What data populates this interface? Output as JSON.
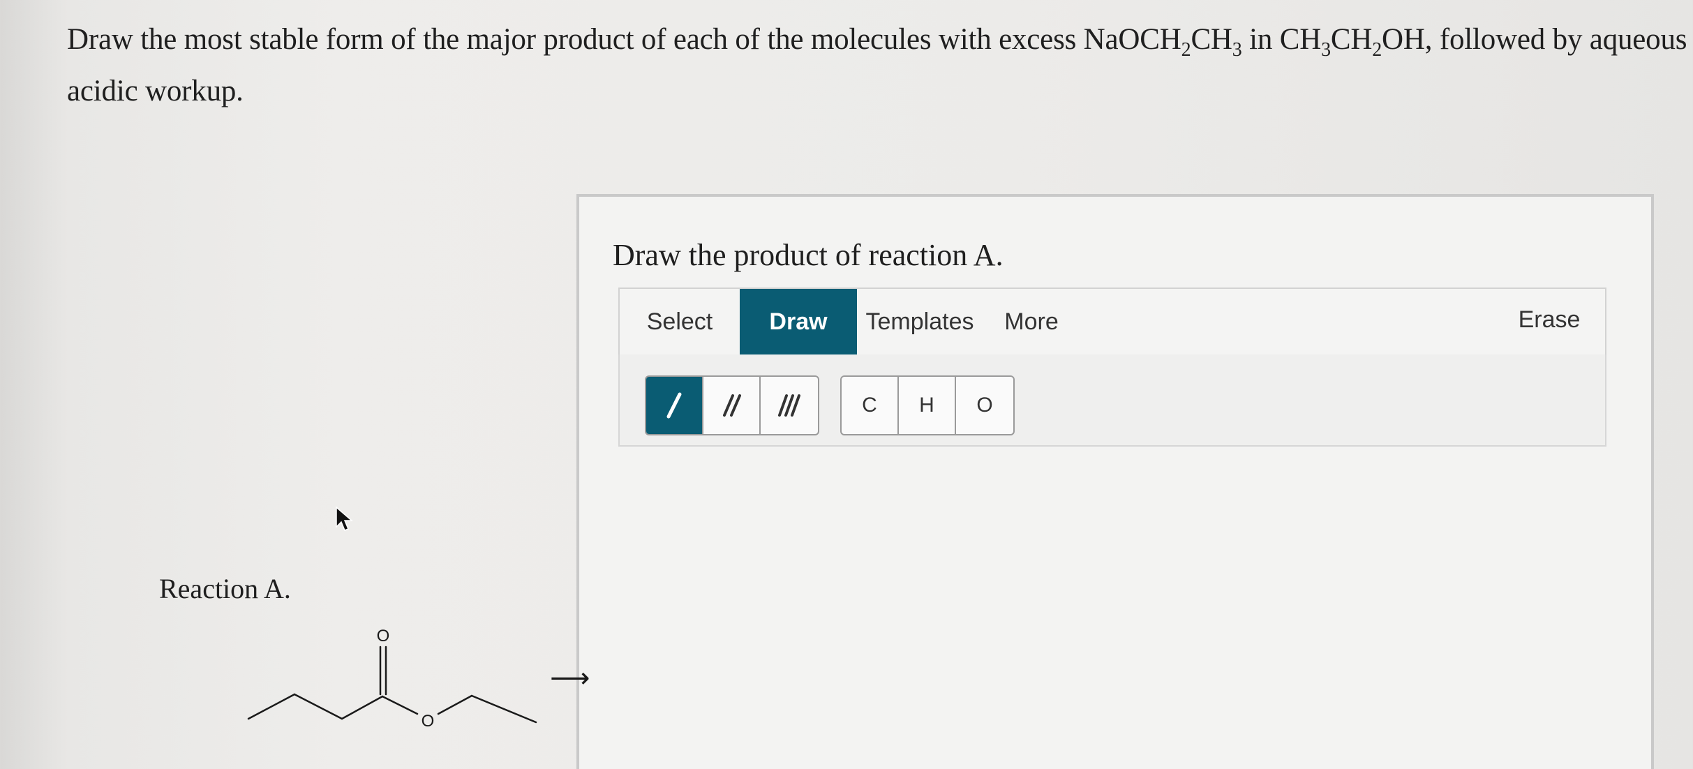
{
  "question": {
    "text_prefix": "Draw the most stable form of the major product of each of the molecules with excess NaOCH",
    "sub1": "2",
    "mid1": "CH",
    "sub2": "3",
    "mid2": " in CH",
    "sub3": "3",
    "mid3": "CH",
    "sub4": "2",
    "text_suffix": "OH, followed by aqueous acidic workup."
  },
  "panel": {
    "title": "Draw the product of reaction A."
  },
  "toolbar": {
    "tabs": [
      "Select",
      "Draw",
      "Templates",
      "More"
    ],
    "active_tab": "Draw",
    "erase_label": "Erase"
  },
  "tools": {
    "bonds": [
      "single-bond-icon",
      "double-bond-icon",
      "triple-bond-icon"
    ],
    "atoms": [
      "C",
      "H",
      "O"
    ]
  },
  "reaction": {
    "label": "Reaction A.",
    "carbonyl_oxygen": "O",
    "ester_oxygen": "O",
    "arrow": "⟶"
  },
  "colors": {
    "accent": "#0a5c73",
    "background": "#ecebe9"
  }
}
